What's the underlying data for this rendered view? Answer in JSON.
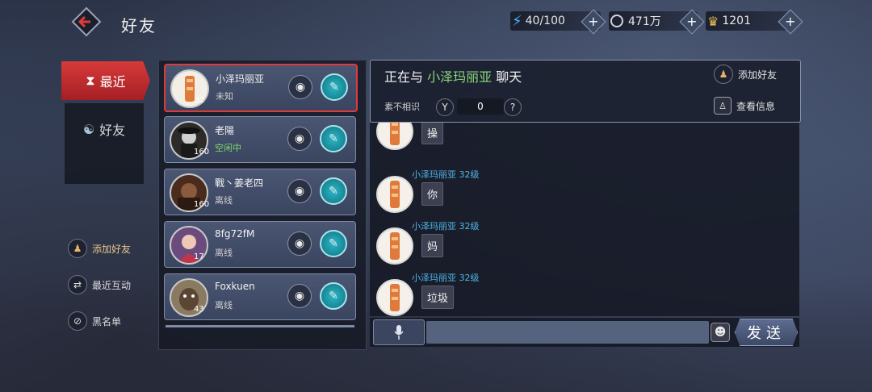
{
  "header": {
    "title": "好友",
    "resources": [
      {
        "icon": "lightning-icon",
        "value": "40/100"
      },
      {
        "icon": "coin-icon",
        "value": "471万"
      },
      {
        "icon": "ingot-icon",
        "value": "1201"
      }
    ]
  },
  "nav": {
    "tabs": [
      {
        "label": "最近",
        "icon": "hourglass-icon",
        "active": true
      },
      {
        "label": "好友",
        "icon": "friends-icon",
        "active": false
      }
    ],
    "links": [
      {
        "label": "添加好友",
        "icon": "add-friend-icon"
      },
      {
        "label": "最近互动",
        "icon": "interaction-icon"
      },
      {
        "label": "黑名单",
        "icon": "blacklist-icon"
      }
    ]
  },
  "friends": [
    {
      "name": "小泽玛丽亚",
      "level": "32",
      "status": "未知"
    },
    {
      "name": "老陽",
      "level": "160",
      "status": "空闲中"
    },
    {
      "name": "戰丶姜老四",
      "level": "160",
      "status": "离线"
    },
    {
      "name": "8fg72fM",
      "level": "17",
      "status": "离线"
    },
    {
      "name": "Foxkuen",
      "level": "43",
      "status": "离线"
    }
  ],
  "chat": {
    "title_prefix": "正在与",
    "partner": "小泽玛丽亚",
    "title_suffix": "聊天",
    "add_friend": "添加好友",
    "view_info": "查看信息",
    "intimacy_label": "素不相识",
    "intimacy_value": "0",
    "help": "?",
    "messages": [
      {
        "sender": "",
        "text": "操"
      },
      {
        "sender": "小泽玛丽亚  32级",
        "text": "你"
      },
      {
        "sender": "小泽玛丽亚  32级",
        "text": "妈"
      },
      {
        "sender": "小泽玛丽亚  32级",
        "text": "垃圾"
      }
    ],
    "send_label": "发送"
  },
  "colors": {
    "accent_red": "#d83a3a",
    "partner_green": "#8ad77a",
    "sender_blue": "#4fb7e8",
    "teal": "#29b8c8"
  }
}
